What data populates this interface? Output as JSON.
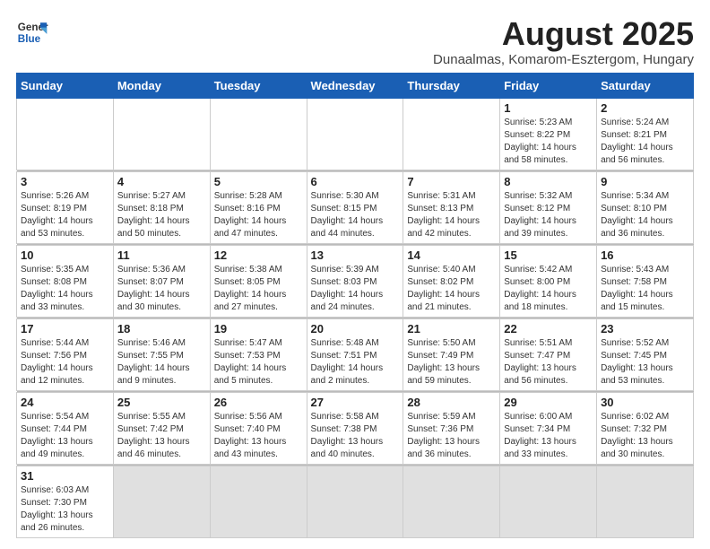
{
  "logo": {
    "text_general": "General",
    "text_blue": "Blue"
  },
  "header": {
    "month_title": "August 2025",
    "subtitle": "Dunaalmas, Komarom-Esztergom, Hungary"
  },
  "weekdays": [
    "Sunday",
    "Monday",
    "Tuesday",
    "Wednesday",
    "Thursday",
    "Friday",
    "Saturday"
  ],
  "weeks": [
    [
      {
        "day": "",
        "info": ""
      },
      {
        "day": "",
        "info": ""
      },
      {
        "day": "",
        "info": ""
      },
      {
        "day": "",
        "info": ""
      },
      {
        "day": "",
        "info": ""
      },
      {
        "day": "1",
        "info": "Sunrise: 5:23 AM\nSunset: 8:22 PM\nDaylight: 14 hours and 58 minutes."
      },
      {
        "day": "2",
        "info": "Sunrise: 5:24 AM\nSunset: 8:21 PM\nDaylight: 14 hours and 56 minutes."
      }
    ],
    [
      {
        "day": "3",
        "info": "Sunrise: 5:26 AM\nSunset: 8:19 PM\nDaylight: 14 hours and 53 minutes."
      },
      {
        "day": "4",
        "info": "Sunrise: 5:27 AM\nSunset: 8:18 PM\nDaylight: 14 hours and 50 minutes."
      },
      {
        "day": "5",
        "info": "Sunrise: 5:28 AM\nSunset: 8:16 PM\nDaylight: 14 hours and 47 minutes."
      },
      {
        "day": "6",
        "info": "Sunrise: 5:30 AM\nSunset: 8:15 PM\nDaylight: 14 hours and 44 minutes."
      },
      {
        "day": "7",
        "info": "Sunrise: 5:31 AM\nSunset: 8:13 PM\nDaylight: 14 hours and 42 minutes."
      },
      {
        "day": "8",
        "info": "Sunrise: 5:32 AM\nSunset: 8:12 PM\nDaylight: 14 hours and 39 minutes."
      },
      {
        "day": "9",
        "info": "Sunrise: 5:34 AM\nSunset: 8:10 PM\nDaylight: 14 hours and 36 minutes."
      }
    ],
    [
      {
        "day": "10",
        "info": "Sunrise: 5:35 AM\nSunset: 8:08 PM\nDaylight: 14 hours and 33 minutes."
      },
      {
        "day": "11",
        "info": "Sunrise: 5:36 AM\nSunset: 8:07 PM\nDaylight: 14 hours and 30 minutes."
      },
      {
        "day": "12",
        "info": "Sunrise: 5:38 AM\nSunset: 8:05 PM\nDaylight: 14 hours and 27 minutes."
      },
      {
        "day": "13",
        "info": "Sunrise: 5:39 AM\nSunset: 8:03 PM\nDaylight: 14 hours and 24 minutes."
      },
      {
        "day": "14",
        "info": "Sunrise: 5:40 AM\nSunset: 8:02 PM\nDaylight: 14 hours and 21 minutes."
      },
      {
        "day": "15",
        "info": "Sunrise: 5:42 AM\nSunset: 8:00 PM\nDaylight: 14 hours and 18 minutes."
      },
      {
        "day": "16",
        "info": "Sunrise: 5:43 AM\nSunset: 7:58 PM\nDaylight: 14 hours and 15 minutes."
      }
    ],
    [
      {
        "day": "17",
        "info": "Sunrise: 5:44 AM\nSunset: 7:56 PM\nDaylight: 14 hours and 12 minutes."
      },
      {
        "day": "18",
        "info": "Sunrise: 5:46 AM\nSunset: 7:55 PM\nDaylight: 14 hours and 9 minutes."
      },
      {
        "day": "19",
        "info": "Sunrise: 5:47 AM\nSunset: 7:53 PM\nDaylight: 14 hours and 5 minutes."
      },
      {
        "day": "20",
        "info": "Sunrise: 5:48 AM\nSunset: 7:51 PM\nDaylight: 14 hours and 2 minutes."
      },
      {
        "day": "21",
        "info": "Sunrise: 5:50 AM\nSunset: 7:49 PM\nDaylight: 13 hours and 59 minutes."
      },
      {
        "day": "22",
        "info": "Sunrise: 5:51 AM\nSunset: 7:47 PM\nDaylight: 13 hours and 56 minutes."
      },
      {
        "day": "23",
        "info": "Sunrise: 5:52 AM\nSunset: 7:45 PM\nDaylight: 13 hours and 53 minutes."
      }
    ],
    [
      {
        "day": "24",
        "info": "Sunrise: 5:54 AM\nSunset: 7:44 PM\nDaylight: 13 hours and 49 minutes."
      },
      {
        "day": "25",
        "info": "Sunrise: 5:55 AM\nSunset: 7:42 PM\nDaylight: 13 hours and 46 minutes."
      },
      {
        "day": "26",
        "info": "Sunrise: 5:56 AM\nSunset: 7:40 PM\nDaylight: 13 hours and 43 minutes."
      },
      {
        "day": "27",
        "info": "Sunrise: 5:58 AM\nSunset: 7:38 PM\nDaylight: 13 hours and 40 minutes."
      },
      {
        "day": "28",
        "info": "Sunrise: 5:59 AM\nSunset: 7:36 PM\nDaylight: 13 hours and 36 minutes."
      },
      {
        "day": "29",
        "info": "Sunrise: 6:00 AM\nSunset: 7:34 PM\nDaylight: 13 hours and 33 minutes."
      },
      {
        "day": "30",
        "info": "Sunrise: 6:02 AM\nSunset: 7:32 PM\nDaylight: 13 hours and 30 minutes."
      }
    ],
    [
      {
        "day": "31",
        "info": "Sunrise: 6:03 AM\nSunset: 7:30 PM\nDaylight: 13 hours and 26 minutes."
      },
      {
        "day": "",
        "info": ""
      },
      {
        "day": "",
        "info": ""
      },
      {
        "day": "",
        "info": ""
      },
      {
        "day": "",
        "info": ""
      },
      {
        "day": "",
        "info": ""
      },
      {
        "day": "",
        "info": ""
      }
    ]
  ]
}
